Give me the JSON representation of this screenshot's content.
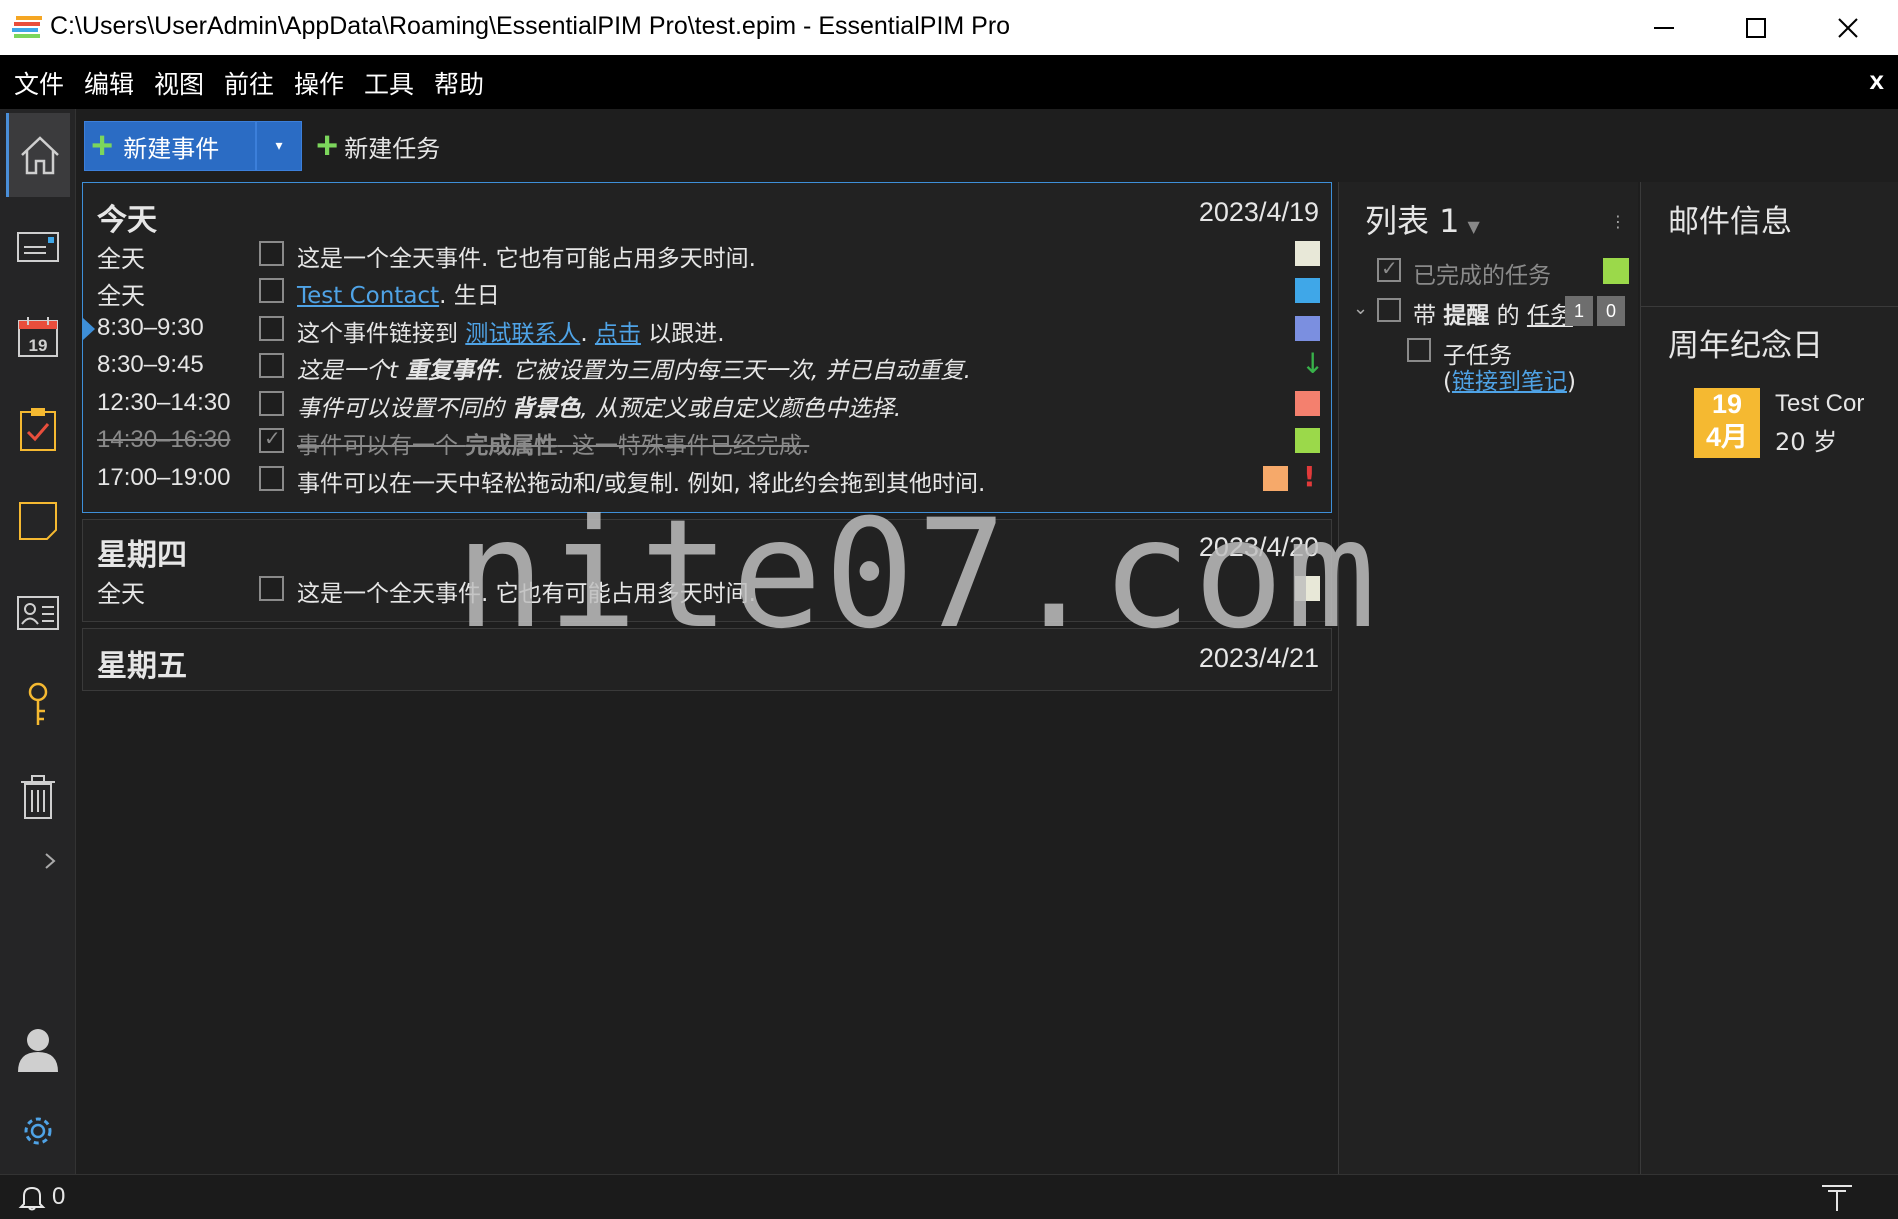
{
  "window": {
    "title": "C:\\Users\\UserAdmin\\AppData\\Roaming\\EssentialPIM Pro\\test.epim - EssentialPIM Pro"
  },
  "menu": {
    "items": [
      "文件",
      "编辑",
      "视图",
      "前往",
      "操作",
      "工具",
      "帮助"
    ],
    "close_label": "x"
  },
  "toolbar": {
    "new_event_label": "新建事件",
    "new_task_label": "新建任务"
  },
  "agenda": {
    "days": [
      {
        "title": "今天",
        "date": "2023/4/19",
        "events": [
          {
            "time": "全天",
            "pre": "这是一个全天事件. 它也有可能占用多天时间.",
            "color": "#e8e8d8"
          },
          {
            "time": "全天",
            "link": "Test Contact",
            "post": ". 生日",
            "color": "#3fa7e8"
          },
          {
            "time": "8:30–9:30",
            "pre": "这个事件链接到 ",
            "link": "测试联系人",
            "mid": ". ",
            "link2": "点击",
            "post": " 以跟进.",
            "color": "#7b8fe0"
          },
          {
            "time": "8:30–9:45",
            "pre": "这是一个t ",
            "bold": "重复事件",
            "post": ". 它被设置为三周内每三天一次, 并已自动重复.",
            "marker": "↓"
          },
          {
            "time": "12:30–14:30",
            "pre": "事件可以设置不同的 ",
            "bold": "背景色",
            "post": ", 从预定义或自定义颜色中选择.",
            "color": "#f4806e"
          },
          {
            "time": "14:30–16:30",
            "pre": "事件可以有一个 ",
            "bold": "完成属性",
            "post": ". 这一特殊事件已经完成.",
            "color": "#9bd94a"
          },
          {
            "time": "17:00–19:00",
            "pre": "事件可以在一天中轻松拖动和/或复制. 例如, 将此约会拖到其他时间.",
            "color": "#f6a96a",
            "marker": "!"
          }
        ]
      },
      {
        "title": "星期四",
        "date": "2023/4/20",
        "events": [
          {
            "time": "全天",
            "pre": "这是一个全天事件. 它也有可能占用多天时间.",
            "color": "#e8e8d8"
          }
        ]
      },
      {
        "title": "星期五",
        "date": "2023/4/21",
        "events": []
      }
    ]
  },
  "tasks": {
    "list_title": "列表 1",
    "completed_label": "已完成的任务",
    "completed_color": "#9bd94a",
    "reminder_task": {
      "pre": "带 ",
      "bold": "提醒",
      "mid": " 的 ",
      "link": "任务"
    },
    "badges": [
      "1",
      "0"
    ],
    "subtask": "子任务",
    "note_link": {
      "open": "(",
      "link": "链接到笔记",
      "close": ")"
    }
  },
  "right_panel": {
    "mail_title": "邮件信息",
    "anniv_title": "周年纪念日",
    "anniv_day": "19",
    "anniv_month": "4月",
    "anniv_name": "Test Cor",
    "anniv_age": "20 岁"
  },
  "watermark": "nite07.com",
  "status": {
    "notification_count": "0"
  }
}
